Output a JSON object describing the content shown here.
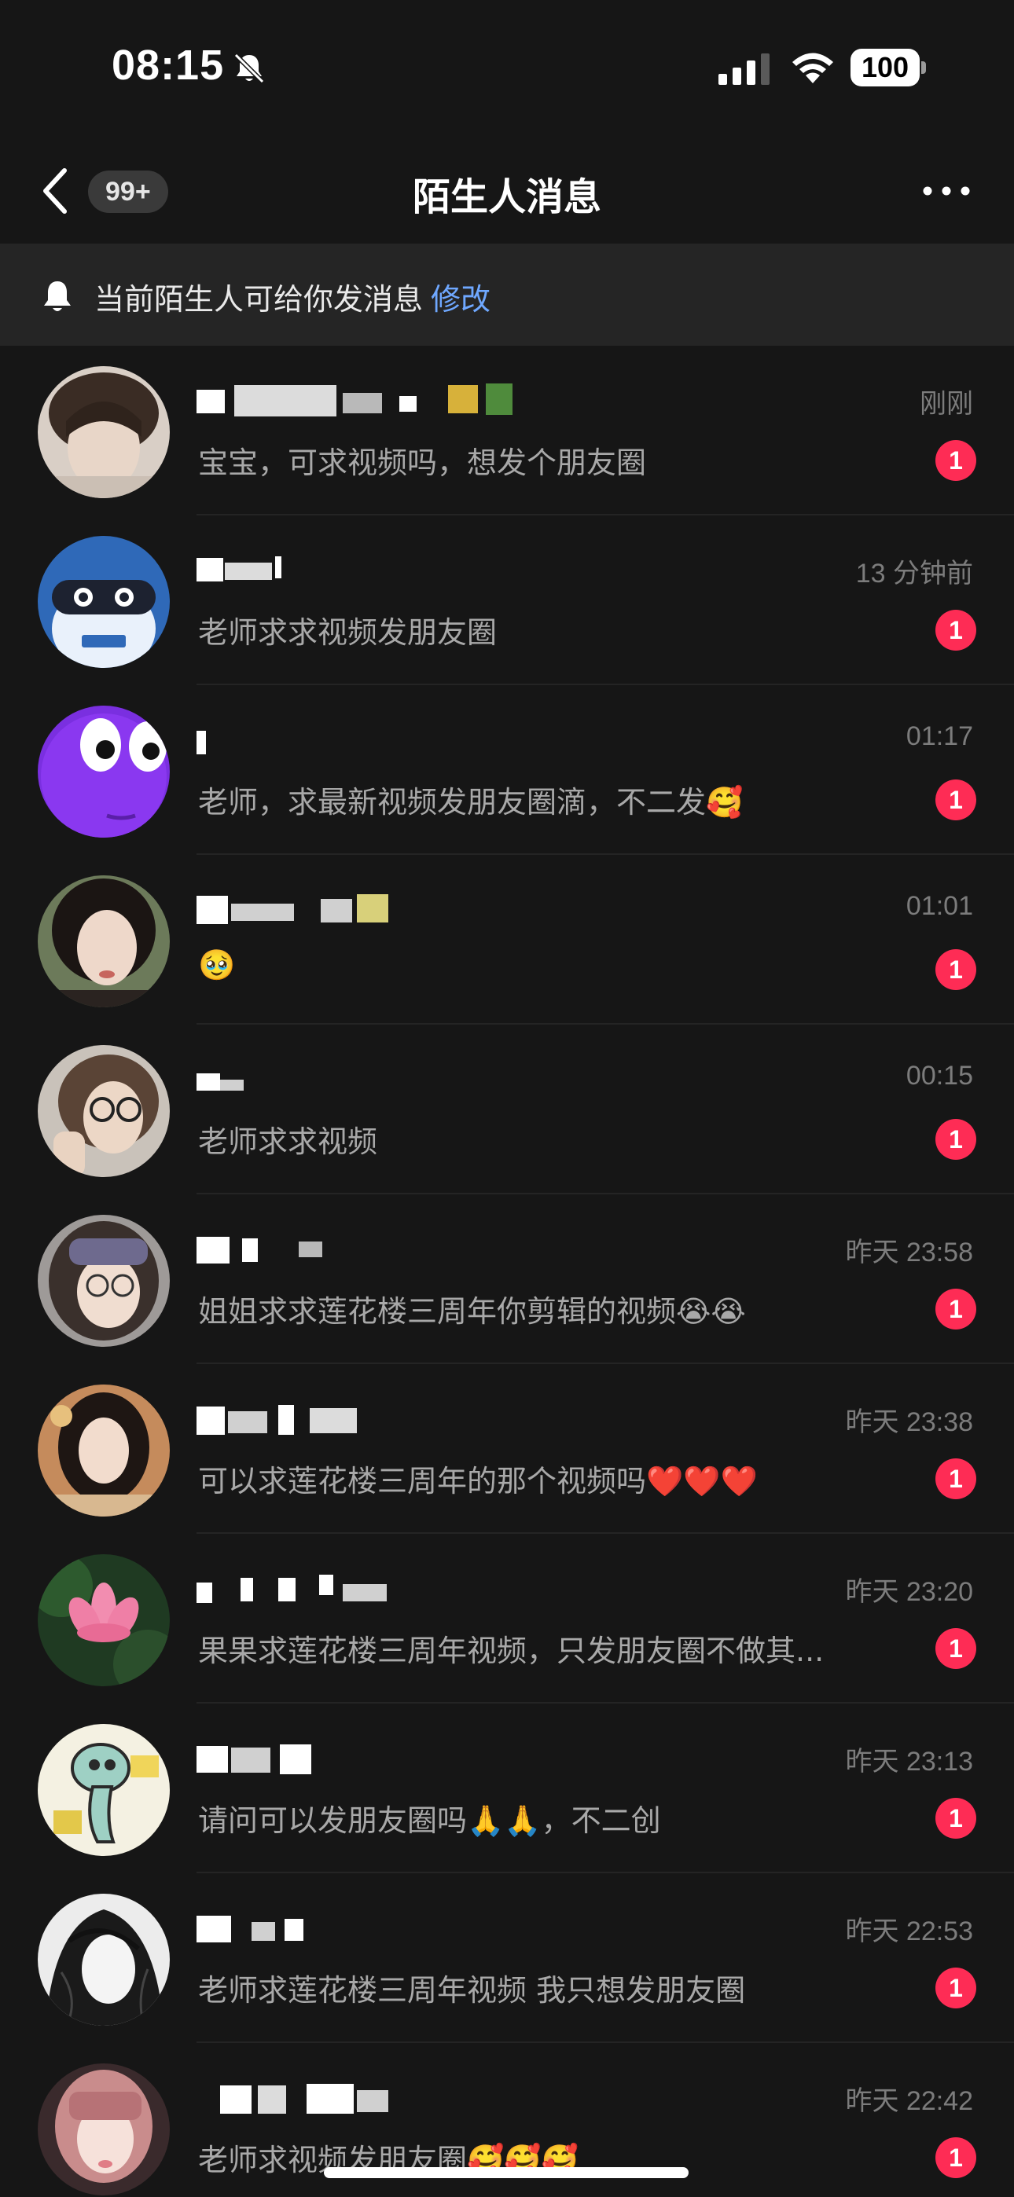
{
  "status_bar": {
    "time": "08:15",
    "battery": "100"
  },
  "header": {
    "back_label": "返回",
    "unread_count": "99+",
    "title": "陌生人消息"
  },
  "notice": {
    "text": "当前陌生人可给你发消息",
    "action": "修改"
  },
  "conversations": [
    {
      "time": "刚刚",
      "preview": "宝宝，可求视频吗，想发个朋友圈",
      "unread": "1"
    },
    {
      "time": "13 分钟前",
      "preview": "老师求求视频发朋友圈",
      "unread": "1"
    },
    {
      "time": "01:17",
      "preview": "老师，求最新视频发朋友圈滴，不二发🥰",
      "unread": "1"
    },
    {
      "time": "01:01",
      "preview": "🥹",
      "unread": "1"
    },
    {
      "time": "00:15",
      "preview": "老师求求视频",
      "unread": "1"
    },
    {
      "time": "昨天 23:58",
      "preview": "姐姐求求莲花楼三周年你剪辑的视频😭😭",
      "unread": "1"
    },
    {
      "time": "昨天 23:38",
      "preview": "可以求莲花楼三周年的那个视频吗❤️❤️❤️",
      "unread": "1"
    },
    {
      "time": "昨天 23:20",
      "preview": "果果求莲花楼三周年视频，只发朋友圈不做其...",
      "unread": "1"
    },
    {
      "time": "昨天 23:13",
      "preview": "请问可以发朋友圈吗🙏🙏，不二创",
      "unread": "1"
    },
    {
      "time": "昨天 22:53",
      "preview": "老师求莲花楼三周年视频 我只想发朋友圈",
      "unread": "1"
    },
    {
      "time": "昨天 22:42",
      "preview": "老师求视频发朋友圈🥰🥰🥰",
      "unread": "1"
    }
  ],
  "colors": {
    "background": "#161616",
    "banner": "#252525",
    "badge": "#fe2c55",
    "link": "#6fa8ff"
  }
}
